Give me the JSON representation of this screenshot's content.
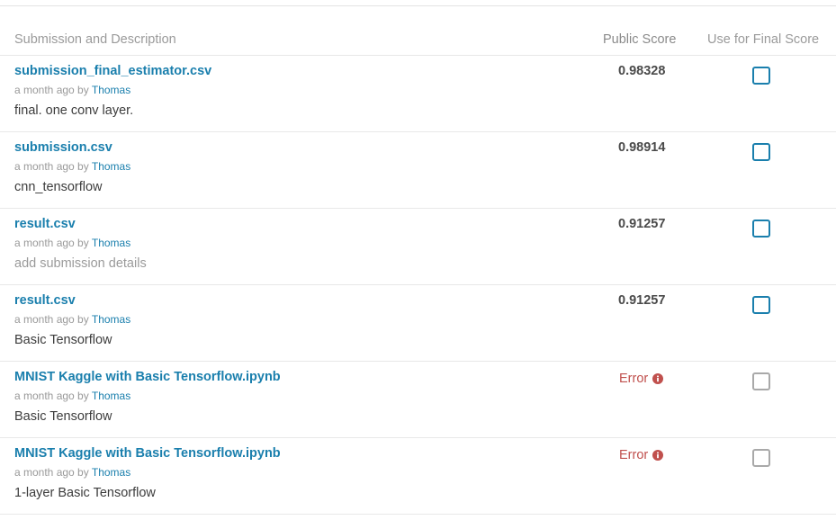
{
  "header": {
    "col_description": "Submission and Description",
    "col_public_score": "Public Score",
    "col_final_score": "Use for Final Score"
  },
  "colors": {
    "link": "#1a7fad",
    "error": "#c0504d",
    "checkbox_enabled": "#1a7fad",
    "checkbox_disabled": "#a9a9a9"
  },
  "submissions": [
    {
      "filename": "submission_final_estimator.csv",
      "time": "a month ago by",
      "author": "Thomas",
      "description": "final. one conv layer.",
      "score": "0.98328",
      "is_error": false,
      "checked": false
    },
    {
      "filename": "submission.csv",
      "time": "a month ago by",
      "author": "Thomas",
      "description": "cnn_tensorflow",
      "score": "0.98914",
      "is_error": false,
      "checked": false
    },
    {
      "filename": "result.csv",
      "time": "a month ago by",
      "author": "Thomas",
      "description": "add submission details",
      "score": "0.91257",
      "is_error": false,
      "checked": false
    },
    {
      "filename": "result.csv",
      "time": "a month ago by",
      "author": "Thomas",
      "description": "Basic Tensorflow",
      "score": "0.91257",
      "is_error": false,
      "checked": false
    },
    {
      "filename": "MNIST Kaggle with Basic Tensorflow.ipynb",
      "time": "a month ago by",
      "author": "Thomas",
      "description": "Basic Tensorflow",
      "score": "Error",
      "is_error": true,
      "checked": false
    },
    {
      "filename": "MNIST Kaggle with Basic Tensorflow.ipynb",
      "time": "a month ago by",
      "author": "Thomas",
      "description": "1-layer Basic Tensorflow",
      "score": "Error",
      "is_error": true,
      "checked": false
    }
  ]
}
